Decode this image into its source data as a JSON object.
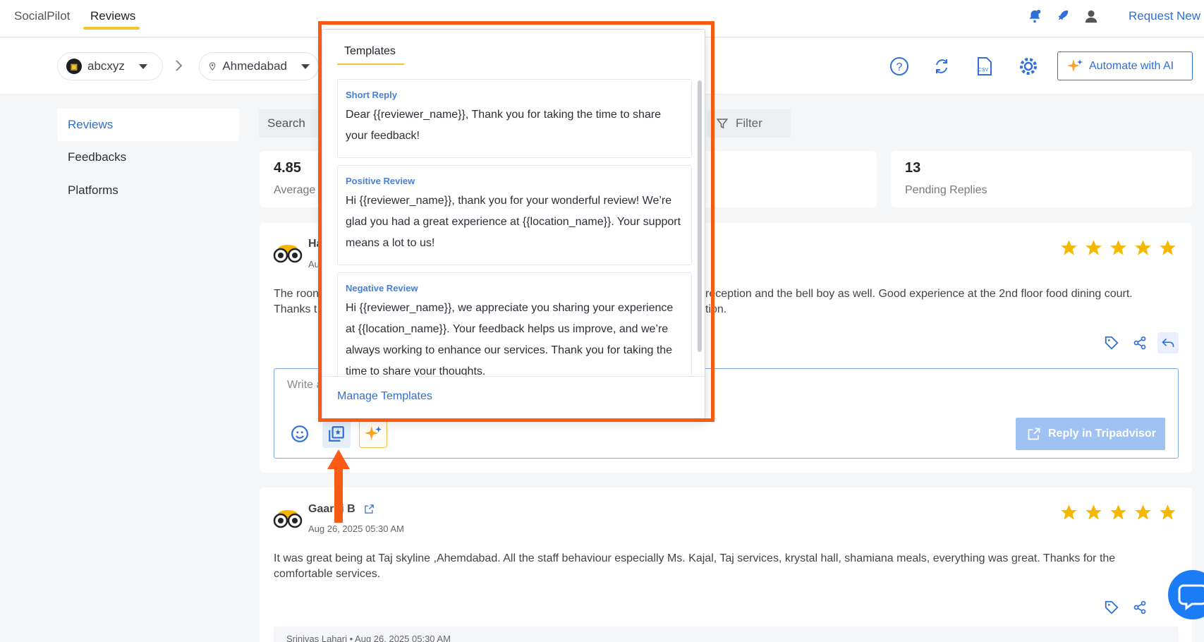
{
  "topnav": {
    "brand": "SocialPilot",
    "active_tab": "Reviews",
    "request_link": "Request New F"
  },
  "subheader": {
    "account": "abcxyz",
    "location": "Ahmedabad",
    "ai_button": "Automate with AI"
  },
  "sidebar": {
    "items": [
      {
        "label": "Reviews",
        "active": true
      },
      {
        "label": "Feedbacks",
        "active": false
      },
      {
        "label": "Platforms",
        "active": false
      }
    ]
  },
  "toolbar": {
    "search_placeholder": "Search",
    "filter_label": "Filter"
  },
  "stats": {
    "average_value": "4.85",
    "average_label": "Average",
    "pending_value": "13",
    "pending_label": "Pending Replies"
  },
  "reviews": [
    {
      "name_partial": "Ha",
      "date_partial": "Au",
      "text_line1_left": "The roon",
      "text_line1_right": "reception and the bell boy as well. Good experience at the 2nd floor food dining court.",
      "text_line2_left": "Thanks t",
      "text_line2_right": "tion.",
      "rating": 5
    },
    {
      "name": "Gaargi B",
      "date": "Aug 26, 2025 05:30 AM",
      "text": "It was great being at Taj skyline ,Ahemdabad. All the staff behaviour especially Ms. Kajal, Taj services, krystal hall, shamiana meals, everything was great. Thanks for the comfortable services.",
      "rating": 5,
      "reply_meta": "Srinivas Lahari • Aug 26, 2025 05:30 AM"
    }
  ],
  "reply_box": {
    "placeholder_partial": "Write a",
    "submit_label": "Reply in Tripadvisor"
  },
  "templates_popup": {
    "title": "Templates",
    "items": [
      {
        "name": "Short Reply",
        "body": "Dear {{reviewer_name}}, Thank you for taking the time to share your feedback!"
      },
      {
        "name": "Positive Review",
        "body": "Hi {{reviewer_name}}, thank you for your wonderful review! We’re glad you had a great experience at {{location_name}}. Your support means a lot to us!"
      },
      {
        "name": "Negative Review",
        "body": "Hi {{reviewer_name}}, we appreciate you sharing your experience at {{location_name}}. Your feedback helps us improve, and we’re always working to enhance our services. Thank you for taking the time to share your thoughts."
      }
    ],
    "manage_link": "Manage Templates"
  },
  "colors": {
    "accent_blue": "#2f6fd6",
    "star_yellow": "#f5b800",
    "highlight_orange": "#fb5a14",
    "tab_underline": "#f4c430"
  }
}
